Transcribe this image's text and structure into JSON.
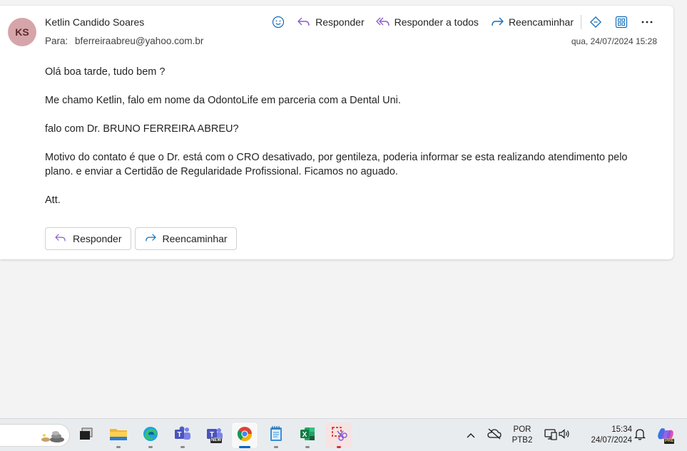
{
  "email": {
    "avatar_initials": "KS",
    "sender": "Ketlin Candido Soares",
    "to_label": "Para:",
    "to_address": "bferreiraabreu@yahoo.com.br",
    "date": "qua, 24/07/2024 15:28",
    "body": [
      "Olá boa tarde, tudo bem ?",
      "Me chamo Ketlin, falo em nome da OdontoLife em parceria com a Dental Uni.",
      "falo com Dr. BRUNO FERREIRA ABREU?",
      "Motivo do contato é que o Dr. está com o CRO desativado, por gentileza, poderia informar se esta realizando atendimento pelo plano. e enviar a Certidão de Regularidade Profissional. Ficamos no aguado.",
      "Att."
    ]
  },
  "toolbar": {
    "reply": "Responder",
    "reply_all": "Responder a todos",
    "forward": "Reencaminhar"
  },
  "actions": {
    "reply": "Responder",
    "forward": "Reencaminhar"
  },
  "taskbar": {
    "lang_top": "POR",
    "lang_bottom": "PTB2",
    "time": "15:34",
    "date": "24/07/2024",
    "teams_badge": "NEW",
    "copilot_badge": "PRE"
  },
  "colors": {
    "avatar_bg": "#d6a5a9",
    "accent_purple": "#8a5cd1",
    "accent_blue": "#0f6cbd"
  }
}
